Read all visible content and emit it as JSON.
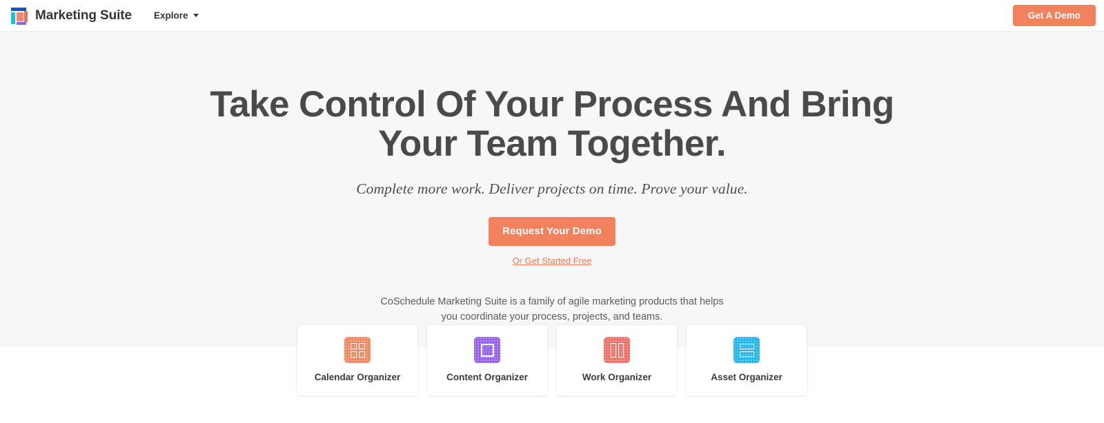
{
  "header": {
    "logo_icon": "marketing-suite-logo-icon",
    "brand_name": "Marketing Suite",
    "nav": [
      {
        "label": "Explore",
        "has_dropdown": true,
        "caret_icon": "chevron-down-icon"
      }
    ],
    "demo_button_label": "Get A Demo"
  },
  "hero": {
    "headline": "Take Control Of Your Process And Bring Your Team Together.",
    "headline_line1": "Take Control Of Your Process And Bring",
    "headline_line2": "Your Team Together.",
    "subhead": "Complete more work. Deliver projects on time. Prove your value.",
    "primary_cta_label": "Request Your Demo",
    "secondary_cta_label": "Or Get Started Free",
    "blurb": "CoSchedule Marketing Suite is a family of agile marketing products that helps you coordinate your process, projects, and teams."
  },
  "products": [
    {
      "label": "Calendar Organizer",
      "icon": "calendar-grid-icon",
      "color": "#f4865f"
    },
    {
      "label": "Content Organizer",
      "icon": "content-square-icon",
      "color": "#9561e8"
    },
    {
      "label": "Work Organizer",
      "icon": "work-columns-icon",
      "color": "#ef6f6a"
    },
    {
      "label": "Asset Organizer",
      "icon": "asset-rows-icon",
      "color": "#22b6ec"
    }
  ],
  "colors": {
    "accent_orange": "#f2815e",
    "link_orange": "#f07a52",
    "hero_background": "#f7f7f7",
    "page_background": "#ffffff",
    "heading_text": "#4a4a4a"
  }
}
